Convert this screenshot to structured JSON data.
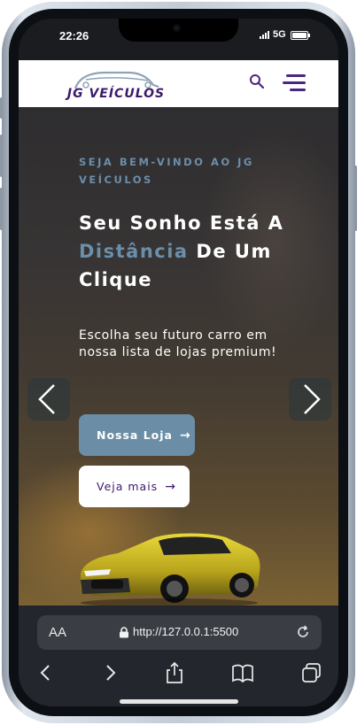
{
  "status": {
    "time": "22:26",
    "network": "5G"
  },
  "brand": {
    "name": "JG VEÍCULOS"
  },
  "hero": {
    "kicker": "SEJA BEM-VINDO AO JG VEÍCULOS",
    "headline_part1": "Seu Sonho Está A ",
    "headline_accent": "Distância",
    "headline_part2": " De Um Clique",
    "subtitle": "Escolha seu futuro carro em nossa lista de lojas premium!",
    "primary_button": "Nossa Loja",
    "secondary_button": "Veja mais"
  },
  "browser": {
    "text_size_label": "AA",
    "url": "http://127.0.0.1:5500"
  },
  "colors": {
    "accent": "#6b8ea6",
    "brand": "#3b1a6e",
    "toolbar": "#23272d"
  },
  "icons": [
    "search-icon",
    "menu-icon",
    "chevron-left-icon",
    "chevron-right-icon",
    "arrow-right-icon",
    "lock-icon",
    "reload-icon",
    "back-icon",
    "forward-icon",
    "share-icon",
    "bookmarks-icon",
    "tabs-icon"
  ]
}
